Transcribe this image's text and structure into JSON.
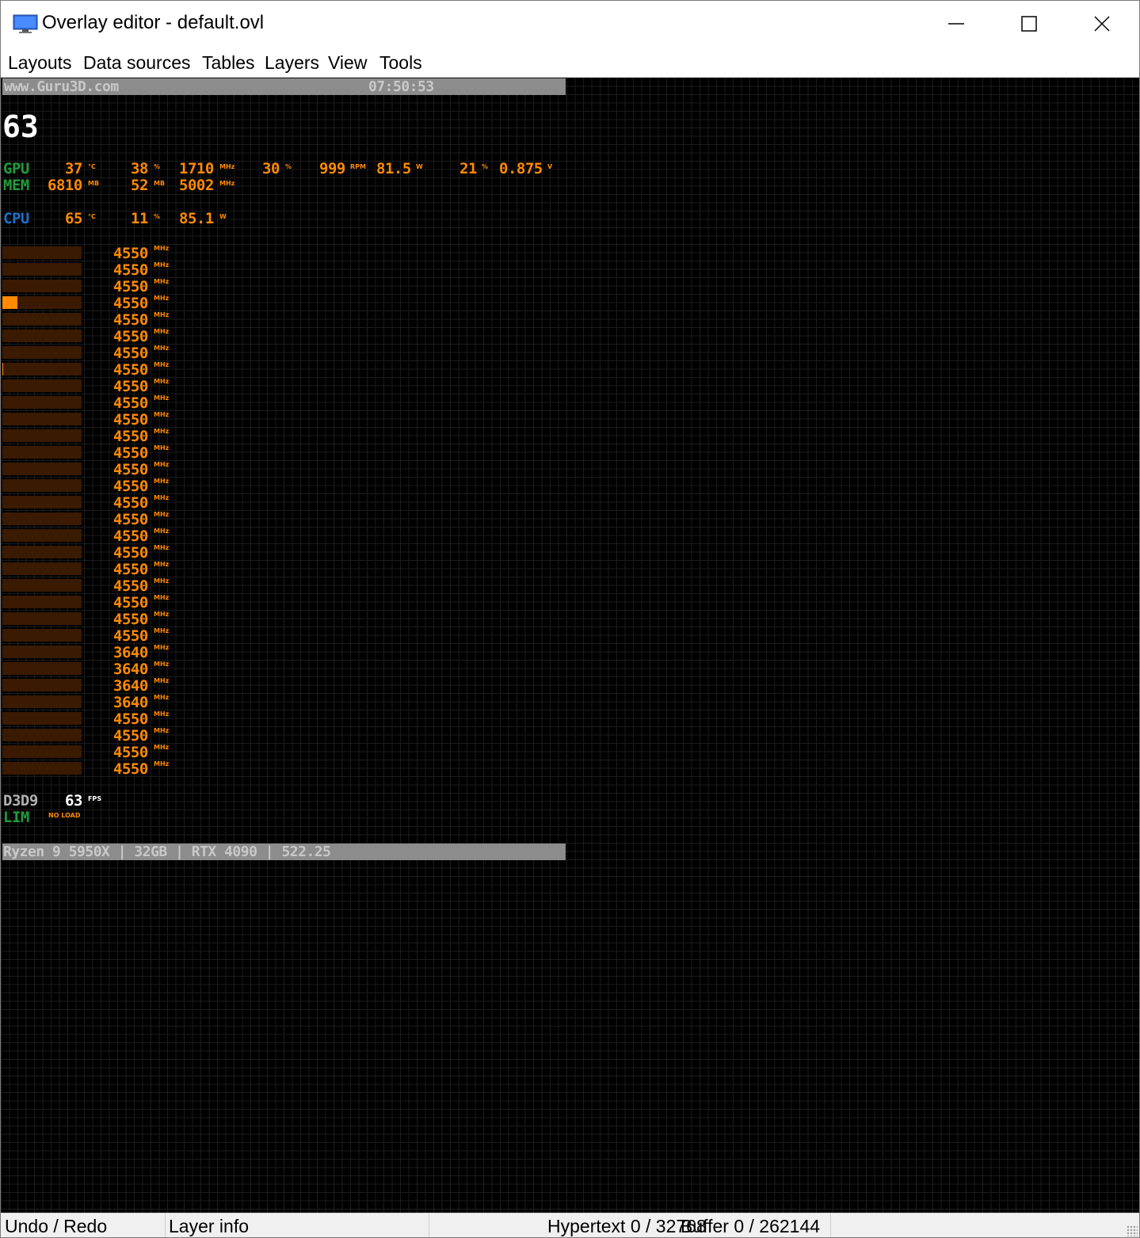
{
  "window": {
    "title": "Overlay editor - default.ovl",
    "icon": "monitor-icon",
    "controls": [
      "minimize-icon",
      "maximize-icon",
      "close-icon"
    ]
  },
  "menu": [
    "Layouts",
    "Data sources",
    "Tables",
    "Layers",
    "View",
    "Tools"
  ],
  "overlay": {
    "header_left": "www.Guru3D.com",
    "header_time": "07:50:53",
    "fps_big": "63",
    "gpu": {
      "label": "GPU",
      "temp": "37",
      "temp_unit": "°C",
      "load": "38",
      "load_unit": "%",
      "clock": "1710",
      "clock_unit": "MHz",
      "fan_pct": "30",
      "fan_pct_unit": "%",
      "fan_rpm": "999",
      "fan_rpm_unit": "RPM",
      "power": "81.5",
      "power_unit": "W",
      "power_pct": "21",
      "power_pct_unit": "%",
      "voltage": "0.875",
      "voltage_unit": "V"
    },
    "mem": {
      "label": "MEM",
      "used": "6810",
      "used_unit": "MB",
      "dyn": "52",
      "dyn_unit": "MB",
      "clock": "5002",
      "clock_unit": "MHz"
    },
    "cpu": {
      "label": "CPU",
      "temp": "65",
      "temp_unit": "°C",
      "load": "11",
      "load_unit": "%",
      "power": "85.1",
      "power_unit": "W"
    },
    "core_unit": "MHz",
    "cores": [
      {
        "clock": "4550",
        "load": 0
      },
      {
        "clock": "4550",
        "load": 0
      },
      {
        "clock": "4550",
        "load": 0
      },
      {
        "clock": "4550",
        "load": 0.19
      },
      {
        "clock": "4550",
        "load": 0
      },
      {
        "clock": "4550",
        "load": 0
      },
      {
        "clock": "4550",
        "load": 0
      },
      {
        "clock": "4550",
        "load": 0.01
      },
      {
        "clock": "4550",
        "load": 0
      },
      {
        "clock": "4550",
        "load": 0
      },
      {
        "clock": "4550",
        "load": 0
      },
      {
        "clock": "4550",
        "load": 0
      },
      {
        "clock": "4550",
        "load": 0
      },
      {
        "clock": "4550",
        "load": 0
      },
      {
        "clock": "4550",
        "load": 0
      },
      {
        "clock": "4550",
        "load": 0
      },
      {
        "clock": "4550",
        "load": 0
      },
      {
        "clock": "4550",
        "load": 0
      },
      {
        "clock": "4550",
        "load": 0
      },
      {
        "clock": "4550",
        "load": 0
      },
      {
        "clock": "4550",
        "load": 0
      },
      {
        "clock": "4550",
        "load": 0
      },
      {
        "clock": "4550",
        "load": 0
      },
      {
        "clock": "4550",
        "load": 0
      },
      {
        "clock": "3640",
        "load": 0
      },
      {
        "clock": "3640",
        "load": 0
      },
      {
        "clock": "3640",
        "load": 0
      },
      {
        "clock": "3640",
        "load": 0
      },
      {
        "clock": "4550",
        "load": 0
      },
      {
        "clock": "4550",
        "load": 0
      },
      {
        "clock": "4550",
        "load": 0
      },
      {
        "clock": "4550",
        "load": 0
      }
    ],
    "api": {
      "label": "D3D9",
      "fps": "63",
      "fps_unit": "FPS",
      "lim_label": "LIM",
      "lim_value": "NO LOAD"
    },
    "footer": "Ryzen 9 5950X | 32GB | RTX 4090 | 522.25"
  },
  "colors": {
    "accent_orange": "#ff8a00",
    "core_bar_bg": "#3a1a00",
    "label_green": "#1f9b3a",
    "label_blue": "#1b6fc9",
    "bar_grey": "#8c8c8c"
  },
  "status": {
    "undo_redo": "Undo / Redo",
    "layer_info": "Layer info",
    "hypertext": "Hypertext 0 / 32768",
    "buffer": "Buffer 0 / 262144"
  }
}
